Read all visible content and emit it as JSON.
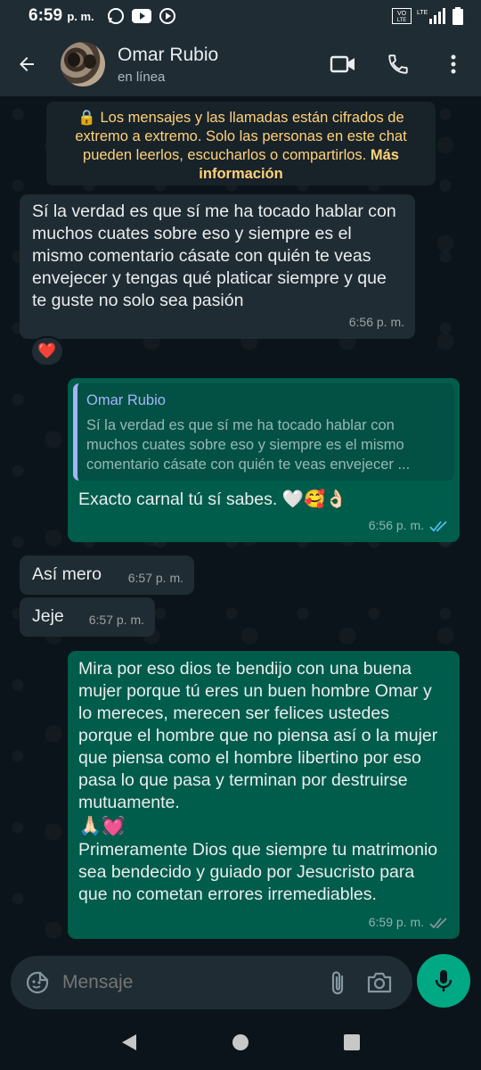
{
  "status_bar": {
    "time": "6:59",
    "ampm": "p. m.",
    "network_label": "LTE",
    "volte_label": "VoLTE"
  },
  "header": {
    "contact_name": "Omar Rubio",
    "contact_status": "en línea"
  },
  "encryption_notice": {
    "text": "🔒 Los mensajes y las llamadas están cifrados de extremo a extremo. Solo las personas en este chat pueden leerlos, escucharlos o compartirlos.",
    "link": "Más información"
  },
  "messages": [
    {
      "direction": "in",
      "text": "Sí la verdad es que sí me ha tocado hablar con muchos cuates sobre eso y siempre es el mismo comentario cásate con quién te veas envejecer y tengas qué platicar siempre y que te guste no solo sea pasión",
      "time": "6:56 p. m.",
      "reaction": "❤️"
    },
    {
      "direction": "out",
      "quote_author": "Omar Rubio",
      "quote_text": "Sí la verdad es que sí me ha tocado hablar con muchos cuates sobre eso y siempre es el mismo comentario cásate con quién te veas envejecer ...",
      "text": "Exacto carnal tú sí sabes.",
      "emojis": "🤍🥰👌🏻",
      "time": "6:56 p. m.",
      "read": true
    },
    {
      "direction": "in",
      "text": "Así mero",
      "time": "6:57 p. m."
    },
    {
      "direction": "in",
      "text": "Jeje",
      "time": "6:57 p. m."
    },
    {
      "direction": "out",
      "text": "Mira por eso dios te bendijo con una buena mujer porque tú eres un buen hombre Omar y lo mereces, merecen ser felices ustedes porque el hombre que no piensa así o la mujer que piensa como el hombre libertino por eso pasa lo que pasa y terminan por destruirse mutuamente.",
      "emojis": "🙏🏻💓",
      "text2": "Primeramente Dios que siempre tu matrimonio sea bendecido y guiado por Jesucristo para que no cometan errores irremediables.",
      "time": "6:59 p. m.",
      "read": false
    }
  ],
  "composer": {
    "placeholder": "Mensaje"
  },
  "colors": {
    "incoming_bubble": "#202c33",
    "outgoing_bubble": "#005c4b",
    "accent_green": "#00a884",
    "read_ticks": "#53bdeb",
    "encryption_text": "#ffd279"
  },
  "icons": [
    "back-arrow-icon",
    "video-call-icon",
    "phone-icon",
    "more-icon",
    "sticker-icon",
    "attach-icon",
    "camera-icon",
    "mic-icon"
  ]
}
